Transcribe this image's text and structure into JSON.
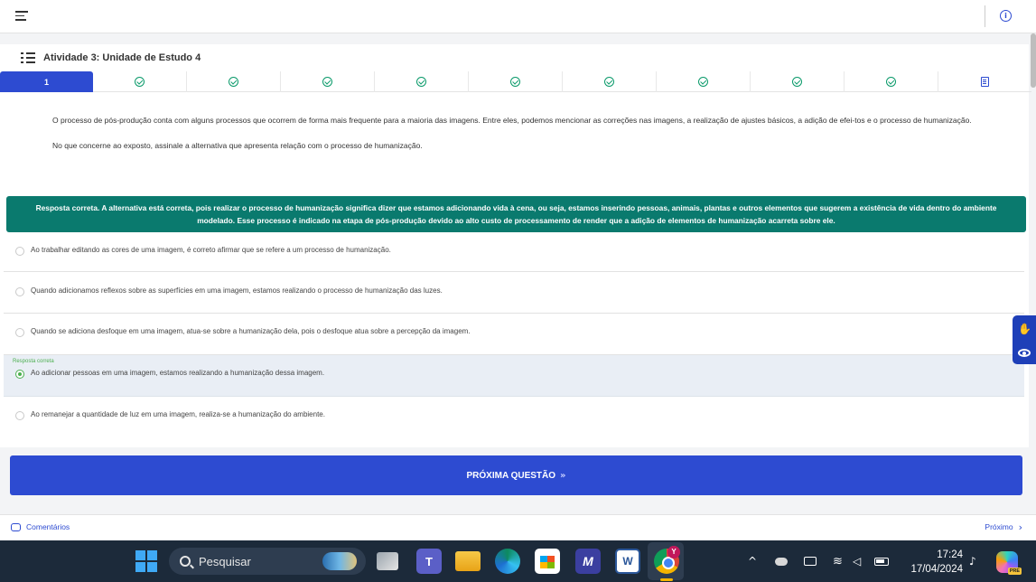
{
  "header": {
    "info_icon": "info-circle-icon"
  },
  "activity": {
    "title": "Atividade 3: Unidade de Estudo 4",
    "steps": [
      {
        "label": "1",
        "state": "active"
      },
      {
        "state": "done"
      },
      {
        "state": "done"
      },
      {
        "state": "done"
      },
      {
        "state": "done"
      },
      {
        "state": "done"
      },
      {
        "state": "done"
      },
      {
        "state": "done"
      },
      {
        "state": "done"
      },
      {
        "state": "done"
      },
      {
        "state": "document"
      }
    ]
  },
  "question": {
    "paragraph1": "O processo de pós-produção conta com alguns processos que ocorrem de forma mais frequente para a maioria das imagens. Entre eles, podemos mencionar as correções nas imagens, a realização de ajustes básicos, a adição de efei-tos e o processo de humanização.",
    "paragraph2": "No que concerne ao exposto, assinale a alternativa que apresenta relação com o processo de humanização."
  },
  "feedback": "Resposta correta. A alternativa está correta, pois realizar o processo de humanização significa dizer que estamos adicionando vida à cena, ou seja, estamos inserindo pessoas, animais, plantas e outros elementos que sugerem a existência de vida dentro do ambiente modelado. Esse processo é indicado na etapa de pós-produção devido ao alto custo de processamento de render que a adição de elementos de humanização acarreta sobre ele.",
  "options": [
    {
      "text": "Ao trabalhar editando as cores de uma imagem, é correto afirmar que se refere a um processo de humanização.",
      "selected": false
    },
    {
      "text": "Quando adicionamos reflexos sobre as superfícies em uma imagem, estamos realizando o processo de humanização das luzes.",
      "selected": false
    },
    {
      "text": "Quando se adiciona desfoque em uma imagem, atua-se sobre a humanização dela, pois o desfoque atua sobre a percepção da imagem.",
      "selected": false
    },
    {
      "text": "Ao adicionar pessoas em uma imagem, estamos realizando a humanização dessa imagem.",
      "selected": true
    },
    {
      "text": "Ao remanejar a quantidade de luz em uma imagem, realiza-se a humanização do ambiente.",
      "selected": false
    }
  ],
  "correct_label": "Resposta correta",
  "next_button": "PRÓXIMA QUESTÃO",
  "footer": {
    "comments": "Comentários",
    "next": "Próximo"
  },
  "taskbar": {
    "search_placeholder": "Pesquisar",
    "chrome_badge": "Y",
    "time": "17:24",
    "date": "17/04/2024",
    "copilot_badge": "PRE"
  },
  "colors": {
    "primary": "#2d4bd1",
    "feedback_bg": "#0a7a6e",
    "success": "#4caf50"
  }
}
